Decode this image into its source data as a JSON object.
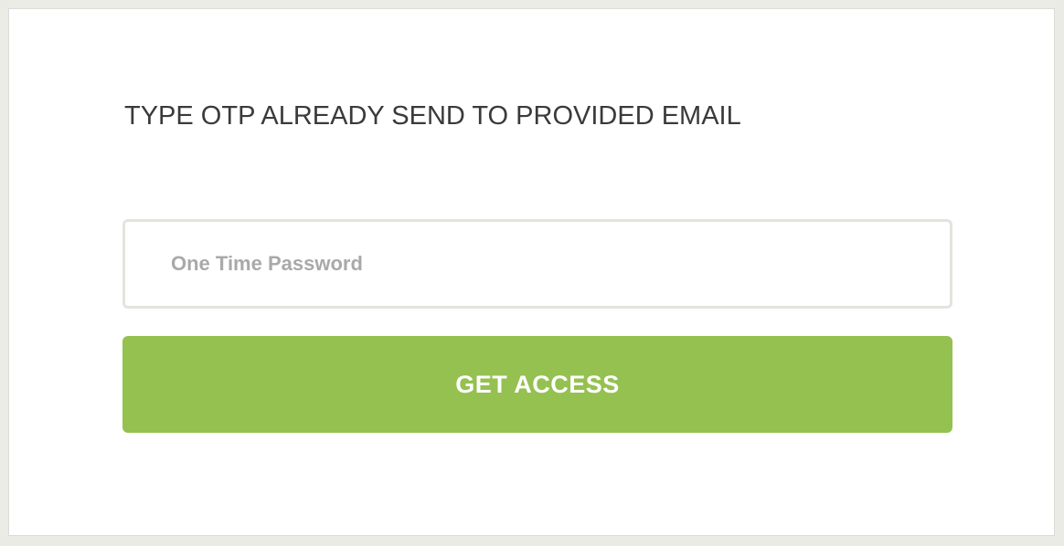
{
  "form": {
    "title": "TYPE OTP ALREADY SEND TO PROVIDED EMAIL",
    "otp_input": {
      "value": "",
      "placeholder": "One Time Password"
    },
    "submit_label": "GET ACCESS"
  },
  "colors": {
    "page_background": "#ebebe6",
    "card_background": "#ffffff",
    "button_background": "#94c150",
    "button_text": "#ffffff",
    "title_text": "#3a3a3a",
    "placeholder_text": "#a9a9a9",
    "input_border": "#e4e4de"
  }
}
